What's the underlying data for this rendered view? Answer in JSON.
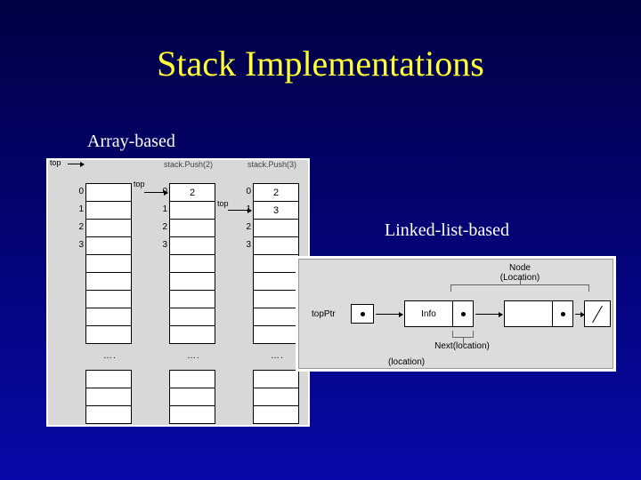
{
  "title": "Stack Implementations",
  "array_section": {
    "label": "Array-based",
    "top_label": "top",
    "columns": [
      {
        "header": "",
        "top_row": -1,
        "indices": [
          "0",
          "1",
          "2",
          "3"
        ],
        "values": [
          "",
          "",
          "",
          ""
        ]
      },
      {
        "header": "stack.Push(2)",
        "top_row": 0,
        "indices": [
          "0",
          "1",
          "2",
          "3"
        ],
        "values": [
          "2",
          "",
          "",
          ""
        ]
      },
      {
        "header": "stack.Push(3)",
        "top_row": 1,
        "indices": [
          "0",
          "1",
          "2",
          "3"
        ],
        "values": [
          "2",
          "3",
          "",
          ""
        ]
      }
    ],
    "ellipsis": "…."
  },
  "linked_section": {
    "label": "Linked-list-based",
    "node_caption_line1": "Node",
    "node_caption_line2": "(Location)",
    "topptr_label": "topPtr",
    "info_label": "Info",
    "next_caption": "Next(location)",
    "loc_caption": "(location)"
  }
}
